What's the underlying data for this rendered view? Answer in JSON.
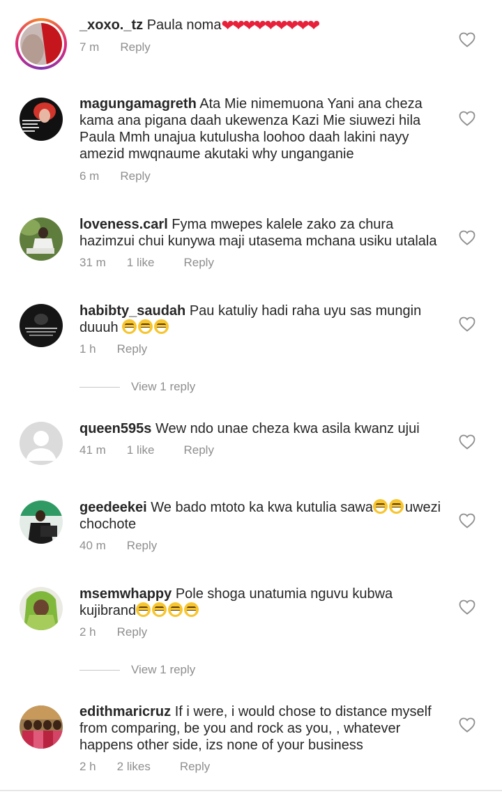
{
  "comments": [
    {
      "username": "_xoxo._tz",
      "text": " Paula noma",
      "time": "7 m",
      "likes": "",
      "reply": "Reply"
    },
    {
      "username": "magungamagreth",
      "text": " Ata Mie nimemuona Yani ana cheza kama ana pigana daah ukewenza Kazi Mie siuwezi hila Paula Mmh unajua kutulusha loohoo daah lakini nayy amezid mwqnaume akutaki why unganganie",
      "time": "6 m",
      "likes": "",
      "reply": "Reply"
    },
    {
      "username": "loveness.carl",
      "text": " Fyma mwepes kalele zako za chura hazimzui chui kunywa maji utasema mchana usiku utalala",
      "time": "31 m",
      "likes": "1 like",
      "reply": "Reply"
    },
    {
      "username": "habibty_saudah",
      "text": " Pau katuliy hadi raha uyu sas mungin duuuh ",
      "time": "1 h",
      "likes": "",
      "reply": "Reply",
      "view_replies": "View 1 reply"
    },
    {
      "username": "queen595s",
      "text": " Wew ndo unae cheza kwa asila kwanz ujui",
      "time": "41 m",
      "likes": "1 like",
      "reply": "Reply"
    },
    {
      "username": "geedeekei",
      "text_a": " We bado mtoto ka kwa kutulia sawa",
      "text_b": "uwezi chochote",
      "time": "40 m",
      "likes": "",
      "reply": "Reply"
    },
    {
      "username": "msemwhappy",
      "text": " Pole shoga unatumia nguvu kubwa kujibrand",
      "time": "2 h",
      "likes": "",
      "reply": "Reply",
      "view_replies": "View 1 reply"
    },
    {
      "username": "edithmaricruz",
      "text": " If i were, i would chose to distance myself from comparing, be you and rock as you, , whatever happens other side, izs none of your business",
      "time": "2 h",
      "likes": "2 likes",
      "reply": "Reply"
    }
  ],
  "icons": {
    "like": "heart-outline-icon",
    "avatar_placeholder": "default-avatar-icon"
  },
  "colors": {
    "text": "#262626",
    "meta": "#8e8e8e",
    "story_ring": "#dd2a7b"
  }
}
